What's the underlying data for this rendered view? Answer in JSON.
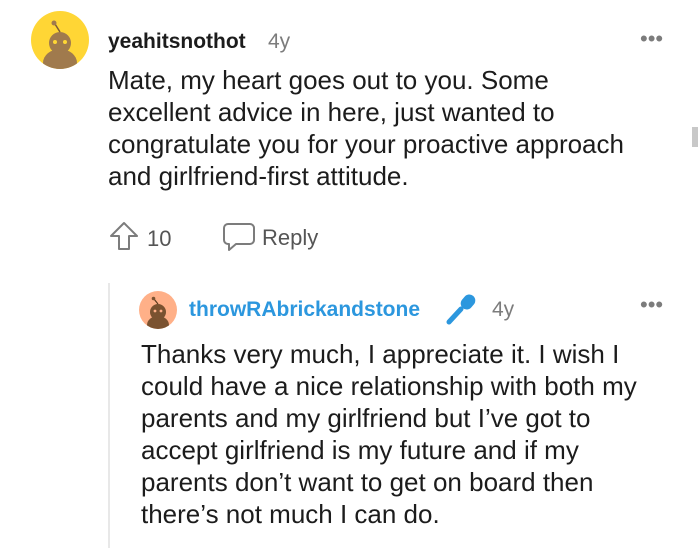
{
  "comment": {
    "username": "yeahitsnothot",
    "age": "4y",
    "lines": [
      "Mate, my heart goes out to you. Some",
      "excellent advice in here, just wanted to",
      "congratulate you for your proactive approach",
      "and girlfriend-first attitude."
    ],
    "votes": "10",
    "reply_label": "Reply",
    "more": "•••"
  },
  "reply": {
    "username": "throwRAbrickandstone",
    "age": "4y",
    "lines": [
      "Thanks very much, I appreciate it. I wish I",
      "could have a nice relationship with both my",
      "parents and my girlfriend but I’ve got to",
      "accept girlfriend is my future and if my",
      "parents don’t want to get on board then",
      "there’s not much I can do."
    ],
    "more": "•••"
  },
  "colors": {
    "top_avatar_bg": "#ffd635",
    "reply_avatar_bg": "#ffb088",
    "op_username": "#2c97de",
    "mic_icon": "#2c97de",
    "meta_gray": "#7c7c7c"
  },
  "icons": {
    "upvote": "upvote-arrow-icon",
    "reply": "speech-bubble-icon",
    "mic": "microphone-icon",
    "more": "more-dots-icon"
  }
}
